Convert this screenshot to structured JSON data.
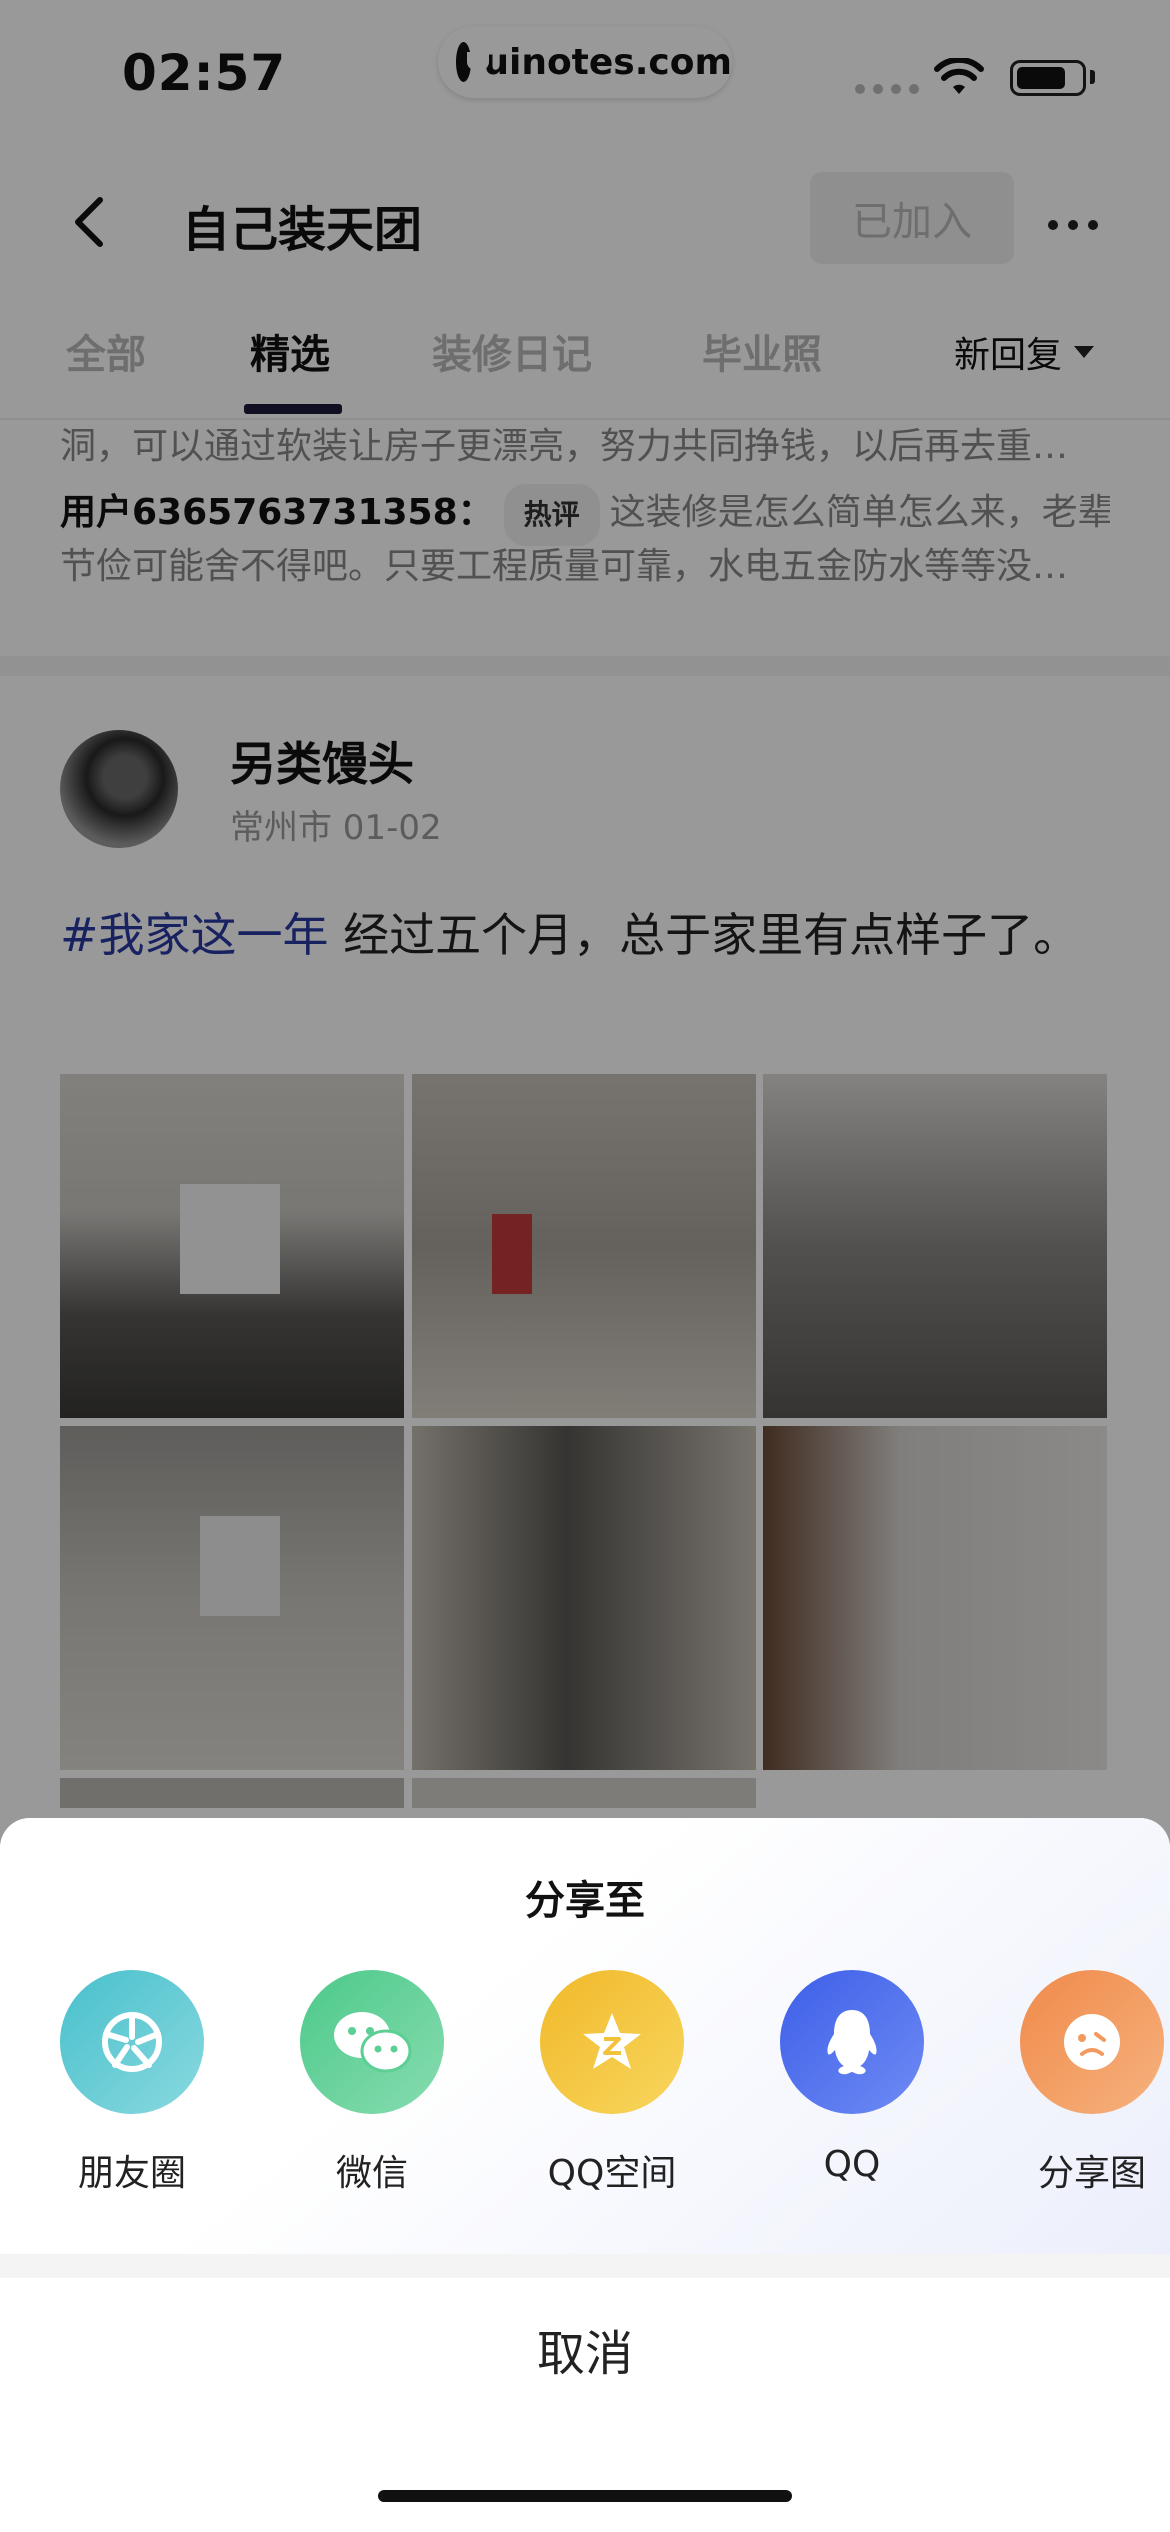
{
  "status_bar": {
    "time": "02:57",
    "site": "uinotes.com"
  },
  "header": {
    "title": "自己装天团",
    "joined_label": "已加入"
  },
  "tabs": [
    {
      "label": "全部"
    },
    {
      "label": "精选"
    },
    {
      "label": "装修日记"
    },
    {
      "label": "毕业照"
    }
  ],
  "sort_label": "新回复",
  "comments": {
    "line1": "洞，可以通过软装让房子更漂亮，努力共同挣钱，以后再去重…",
    "user": "用户6365763731358：",
    "badge": "热评",
    "text_a": "这装修是怎么简单怎么来，老辈人",
    "text_b": "节俭可能舍不得吧。只要工程质量可靠，水电五金防水等等没…"
  },
  "post": {
    "author": "另类馒头",
    "meta": "常州市 01-02",
    "topic": "#我家这一年",
    "text": " 经过五个月，总于家里有点样子了。"
  },
  "share_sheet": {
    "title": "分享至",
    "items": [
      {
        "label": "朋友圈",
        "icon": "moments-icon",
        "color": "#5ec9d3"
      },
      {
        "label": "微信",
        "icon": "wechat-icon",
        "color": "#5ccf94"
      },
      {
        "label": "QQ空间",
        "icon": "qzone-icon",
        "color": "#f6c43a"
      },
      {
        "label": "QQ",
        "icon": "qq-icon",
        "color": "#4a6cf0"
      },
      {
        "label": "分享图",
        "icon": "share-image-icon",
        "color": "#f29a5e"
      }
    ],
    "cancel_label": "取消"
  }
}
